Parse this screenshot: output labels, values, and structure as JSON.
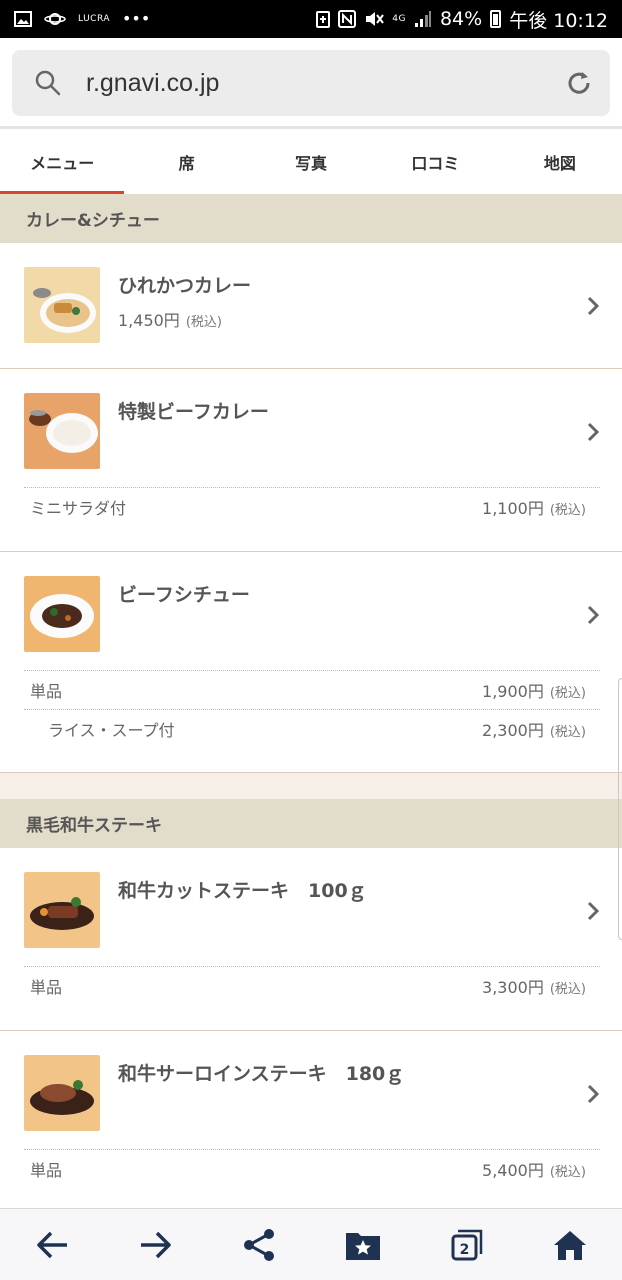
{
  "status_bar": {
    "carrier_label": "LUCRA",
    "network": "4G",
    "battery_percent": "84%",
    "time": "午後 10:12"
  },
  "browser": {
    "url": "r.gnavi.co.jp"
  },
  "tabs": [
    {
      "label": "メニュー",
      "active": true
    },
    {
      "label": "席",
      "active": false
    },
    {
      "label": "写真",
      "active": false
    },
    {
      "label": "口コミ",
      "active": false
    },
    {
      "label": "地図",
      "active": false
    }
  ],
  "sections": [
    {
      "title": "カレー&シチュー",
      "items": [
        {
          "name": "ひれかつカレー",
          "price": "1,450円",
          "tax": "(税込)"
        },
        {
          "name": "特製ビーフカレー",
          "options": [
            {
              "label": "ミニサラダ付",
              "price": "1,100円",
              "tax": "(税込)"
            }
          ]
        },
        {
          "name": "ビーフシチュー",
          "options": [
            {
              "label": "単品",
              "price": "1,900円",
              "tax": "(税込)"
            },
            {
              "label": "ライス・スープ付",
              "price": "2,300円",
              "tax": "(税込)"
            }
          ]
        }
      ]
    },
    {
      "title": "黒毛和牛ステーキ",
      "items": [
        {
          "name": "和牛カットステーキ　100ｇ",
          "options": [
            {
              "label": "単品",
              "price": "3,300円",
              "tax": "(税込)"
            }
          ]
        },
        {
          "name": "和牛サーロインステーキ　180ｇ",
          "options": [
            {
              "label": "単品",
              "price": "5,400円",
              "tax": "(税込)"
            }
          ]
        }
      ]
    }
  ],
  "bottom_nav": {
    "tab_count": "2",
    "icons": [
      "back-arrow-icon",
      "forward-arrow-icon",
      "share-icon",
      "bookmarks-icon",
      "tabs-icon",
      "home-icon"
    ]
  },
  "colors": {
    "accent": "#d9442f",
    "section_bg": "#e2dccb",
    "nav_icon": "#1f3251"
  }
}
